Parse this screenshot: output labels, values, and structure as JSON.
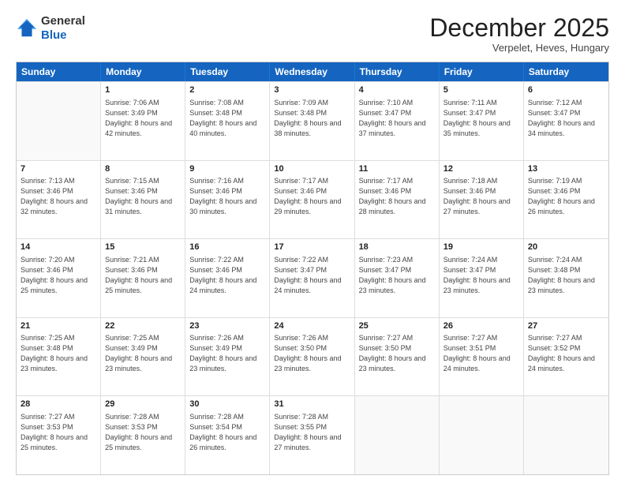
{
  "logo": {
    "line1": "General",
    "line2": "Blue"
  },
  "title": "December 2025",
  "subtitle": "Verpelet, Heves, Hungary",
  "days": [
    "Sunday",
    "Monday",
    "Tuesday",
    "Wednesday",
    "Thursday",
    "Friday",
    "Saturday"
  ],
  "weeks": [
    [
      {
        "day": "",
        "sunrise": "",
        "sunset": "",
        "daylight": ""
      },
      {
        "day": "1",
        "sunrise": "Sunrise: 7:06 AM",
        "sunset": "Sunset: 3:49 PM",
        "daylight": "Daylight: 8 hours and 42 minutes."
      },
      {
        "day": "2",
        "sunrise": "Sunrise: 7:08 AM",
        "sunset": "Sunset: 3:48 PM",
        "daylight": "Daylight: 8 hours and 40 minutes."
      },
      {
        "day": "3",
        "sunrise": "Sunrise: 7:09 AM",
        "sunset": "Sunset: 3:48 PM",
        "daylight": "Daylight: 8 hours and 38 minutes."
      },
      {
        "day": "4",
        "sunrise": "Sunrise: 7:10 AM",
        "sunset": "Sunset: 3:47 PM",
        "daylight": "Daylight: 8 hours and 37 minutes."
      },
      {
        "day": "5",
        "sunrise": "Sunrise: 7:11 AM",
        "sunset": "Sunset: 3:47 PM",
        "daylight": "Daylight: 8 hours and 35 minutes."
      },
      {
        "day": "6",
        "sunrise": "Sunrise: 7:12 AM",
        "sunset": "Sunset: 3:47 PM",
        "daylight": "Daylight: 8 hours and 34 minutes."
      }
    ],
    [
      {
        "day": "7",
        "sunrise": "Sunrise: 7:13 AM",
        "sunset": "Sunset: 3:46 PM",
        "daylight": "Daylight: 8 hours and 32 minutes."
      },
      {
        "day": "8",
        "sunrise": "Sunrise: 7:15 AM",
        "sunset": "Sunset: 3:46 PM",
        "daylight": "Daylight: 8 hours and 31 minutes."
      },
      {
        "day": "9",
        "sunrise": "Sunrise: 7:16 AM",
        "sunset": "Sunset: 3:46 PM",
        "daylight": "Daylight: 8 hours and 30 minutes."
      },
      {
        "day": "10",
        "sunrise": "Sunrise: 7:17 AM",
        "sunset": "Sunset: 3:46 PM",
        "daylight": "Daylight: 8 hours and 29 minutes."
      },
      {
        "day": "11",
        "sunrise": "Sunrise: 7:17 AM",
        "sunset": "Sunset: 3:46 PM",
        "daylight": "Daylight: 8 hours and 28 minutes."
      },
      {
        "day": "12",
        "sunrise": "Sunrise: 7:18 AM",
        "sunset": "Sunset: 3:46 PM",
        "daylight": "Daylight: 8 hours and 27 minutes."
      },
      {
        "day": "13",
        "sunrise": "Sunrise: 7:19 AM",
        "sunset": "Sunset: 3:46 PM",
        "daylight": "Daylight: 8 hours and 26 minutes."
      }
    ],
    [
      {
        "day": "14",
        "sunrise": "Sunrise: 7:20 AM",
        "sunset": "Sunset: 3:46 PM",
        "daylight": "Daylight: 8 hours and 25 minutes."
      },
      {
        "day": "15",
        "sunrise": "Sunrise: 7:21 AM",
        "sunset": "Sunset: 3:46 PM",
        "daylight": "Daylight: 8 hours and 25 minutes."
      },
      {
        "day": "16",
        "sunrise": "Sunrise: 7:22 AM",
        "sunset": "Sunset: 3:46 PM",
        "daylight": "Daylight: 8 hours and 24 minutes."
      },
      {
        "day": "17",
        "sunrise": "Sunrise: 7:22 AM",
        "sunset": "Sunset: 3:47 PM",
        "daylight": "Daylight: 8 hours and 24 minutes."
      },
      {
        "day": "18",
        "sunrise": "Sunrise: 7:23 AM",
        "sunset": "Sunset: 3:47 PM",
        "daylight": "Daylight: 8 hours and 23 minutes."
      },
      {
        "day": "19",
        "sunrise": "Sunrise: 7:24 AM",
        "sunset": "Sunset: 3:47 PM",
        "daylight": "Daylight: 8 hours and 23 minutes."
      },
      {
        "day": "20",
        "sunrise": "Sunrise: 7:24 AM",
        "sunset": "Sunset: 3:48 PM",
        "daylight": "Daylight: 8 hours and 23 minutes."
      }
    ],
    [
      {
        "day": "21",
        "sunrise": "Sunrise: 7:25 AM",
        "sunset": "Sunset: 3:48 PM",
        "daylight": "Daylight: 8 hours and 23 minutes."
      },
      {
        "day": "22",
        "sunrise": "Sunrise: 7:25 AM",
        "sunset": "Sunset: 3:49 PM",
        "daylight": "Daylight: 8 hours and 23 minutes."
      },
      {
        "day": "23",
        "sunrise": "Sunrise: 7:26 AM",
        "sunset": "Sunset: 3:49 PM",
        "daylight": "Daylight: 8 hours and 23 minutes."
      },
      {
        "day": "24",
        "sunrise": "Sunrise: 7:26 AM",
        "sunset": "Sunset: 3:50 PM",
        "daylight": "Daylight: 8 hours and 23 minutes."
      },
      {
        "day": "25",
        "sunrise": "Sunrise: 7:27 AM",
        "sunset": "Sunset: 3:50 PM",
        "daylight": "Daylight: 8 hours and 23 minutes."
      },
      {
        "day": "26",
        "sunrise": "Sunrise: 7:27 AM",
        "sunset": "Sunset: 3:51 PM",
        "daylight": "Daylight: 8 hours and 24 minutes."
      },
      {
        "day": "27",
        "sunrise": "Sunrise: 7:27 AM",
        "sunset": "Sunset: 3:52 PM",
        "daylight": "Daylight: 8 hours and 24 minutes."
      }
    ],
    [
      {
        "day": "28",
        "sunrise": "Sunrise: 7:27 AM",
        "sunset": "Sunset: 3:53 PM",
        "daylight": "Daylight: 8 hours and 25 minutes."
      },
      {
        "day": "29",
        "sunrise": "Sunrise: 7:28 AM",
        "sunset": "Sunset: 3:53 PM",
        "daylight": "Daylight: 8 hours and 25 minutes."
      },
      {
        "day": "30",
        "sunrise": "Sunrise: 7:28 AM",
        "sunset": "Sunset: 3:54 PM",
        "daylight": "Daylight: 8 hours and 26 minutes."
      },
      {
        "day": "31",
        "sunrise": "Sunrise: 7:28 AM",
        "sunset": "Sunset: 3:55 PM",
        "daylight": "Daylight: 8 hours and 27 minutes."
      },
      {
        "day": "",
        "sunrise": "",
        "sunset": "",
        "daylight": ""
      },
      {
        "day": "",
        "sunrise": "",
        "sunset": "",
        "daylight": ""
      },
      {
        "day": "",
        "sunrise": "",
        "sunset": "",
        "daylight": ""
      }
    ]
  ]
}
